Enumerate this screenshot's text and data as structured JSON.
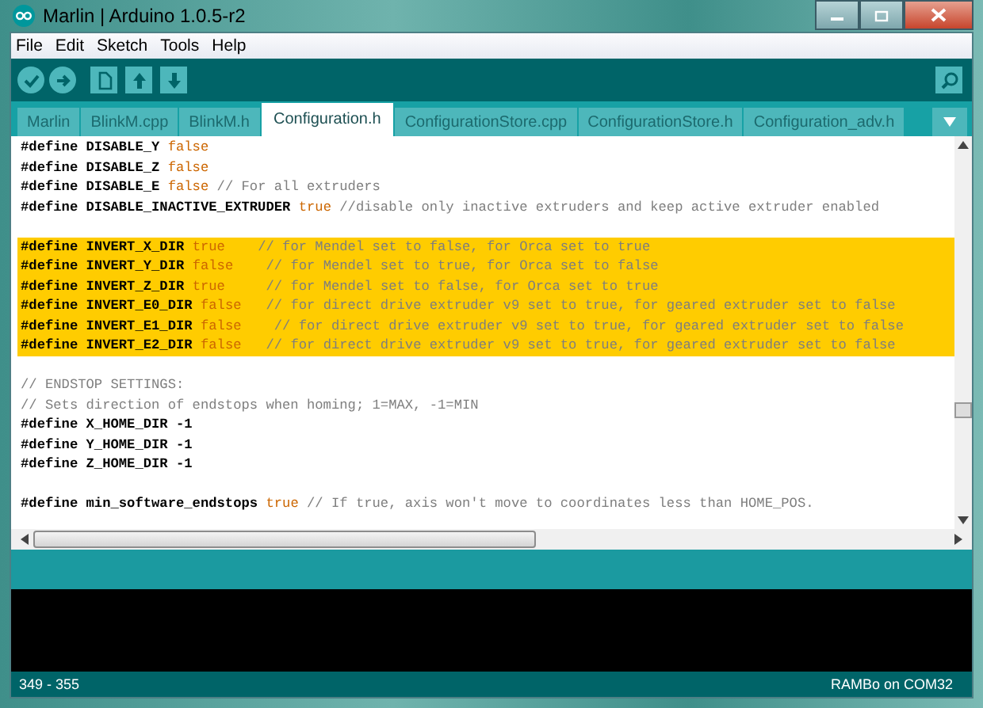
{
  "window": {
    "title": "Marlin | Arduino 1.0.5-r2"
  },
  "menu": [
    "File",
    "Edit",
    "Sketch",
    "Tools",
    "Help"
  ],
  "tabs": [
    {
      "label": "Marlin",
      "selected": false
    },
    {
      "label": "BlinkM.cpp",
      "selected": false
    },
    {
      "label": "BlinkM.h",
      "selected": false
    },
    {
      "label": "Configuration.h",
      "selected": true
    },
    {
      "label": "ConfigurationStore.cpp",
      "selected": false
    },
    {
      "label": "ConfigurationStore.h",
      "selected": false
    },
    {
      "label": "Configuration_adv.h",
      "selected": false
    }
  ],
  "lines": [
    {
      "highlighted": false,
      "segments": [
        {
          "kind": "code",
          "text": "#define DISABLE_Y "
        },
        {
          "kind": "literal",
          "text": "false"
        }
      ]
    },
    {
      "highlighted": false,
      "segments": [
        {
          "kind": "code",
          "text": "#define DISABLE_Z "
        },
        {
          "kind": "literal",
          "text": "false"
        }
      ]
    },
    {
      "highlighted": false,
      "segments": [
        {
          "kind": "code",
          "text": "#define DISABLE_E "
        },
        {
          "kind": "literal",
          "text": "false"
        },
        {
          "kind": "comment",
          "text": " // For all extruders"
        }
      ]
    },
    {
      "highlighted": false,
      "segments": [
        {
          "kind": "code",
          "text": "#define DISABLE_INACTIVE_EXTRUDER "
        },
        {
          "kind": "literal",
          "text": "true"
        },
        {
          "kind": "comment",
          "text": " //disable only inactive extruders and keep active extruder enabled"
        }
      ]
    },
    {
      "highlighted": false
    },
    {
      "highlighted": true,
      "segments": [
        {
          "kind": "code",
          "text": "#define INVERT_X_DIR "
        },
        {
          "kind": "literal",
          "text": "true"
        },
        {
          "kind": "comment",
          "text": "    // for Mendel set to false, for Orca set to true"
        }
      ]
    },
    {
      "highlighted": true,
      "segments": [
        {
          "kind": "code",
          "text": "#define INVERT_Y_DIR "
        },
        {
          "kind": "literal",
          "text": "false"
        },
        {
          "kind": "comment",
          "text": "    // for Mendel set to true, for Orca set to false"
        }
      ]
    },
    {
      "highlighted": true,
      "segments": [
        {
          "kind": "code",
          "text": "#define INVERT_Z_DIR "
        },
        {
          "kind": "literal",
          "text": "true"
        },
        {
          "kind": "comment",
          "text": "     // for Mendel set to false, for Orca set to true"
        }
      ]
    },
    {
      "highlighted": true,
      "segments": [
        {
          "kind": "code",
          "text": "#define INVERT_E0_DIR "
        },
        {
          "kind": "literal",
          "text": "false"
        },
        {
          "kind": "comment",
          "text": "   // for direct drive extruder v9 set to true, for geared extruder set to false"
        }
      ]
    },
    {
      "highlighted": true,
      "segments": [
        {
          "kind": "code",
          "text": "#define INVERT_E1_DIR "
        },
        {
          "kind": "literal",
          "text": "false"
        },
        {
          "kind": "comment",
          "text": "    // for direct drive extruder v9 set to true, for geared extruder set to false"
        }
      ]
    },
    {
      "highlighted": true,
      "segments": [
        {
          "kind": "code",
          "text": "#define INVERT_E2_DIR "
        },
        {
          "kind": "literal",
          "text": "false"
        },
        {
          "kind": "comment",
          "text": "   // for direct drive extruder v9 set to true, for geared extruder set to false"
        }
      ]
    },
    {
      "highlighted": false
    },
    {
      "highlighted": false,
      "segments": [
        {
          "kind": "comment",
          "text": "// ENDSTOP SETTINGS:"
        }
      ]
    },
    {
      "highlighted": false,
      "segments": [
        {
          "kind": "comment",
          "text": "// Sets direction of endstops when homing; 1=MAX, -1=MIN"
        }
      ]
    },
    {
      "highlighted": false,
      "segments": [
        {
          "kind": "code",
          "text": "#define X_HOME_DIR -1"
        }
      ]
    },
    {
      "highlighted": false,
      "segments": [
        {
          "kind": "code",
          "text": "#define Y_HOME_DIR -1"
        }
      ]
    },
    {
      "highlighted": false,
      "segments": [
        {
          "kind": "code",
          "text": "#define Z_HOME_DIR -1"
        }
      ]
    },
    {
      "highlighted": false
    },
    {
      "highlighted": false,
      "segments": [
        {
          "kind": "code",
          "text": "#define min_software_endstops "
        },
        {
          "kind": "literal",
          "text": "true"
        },
        {
          "kind": "comment",
          "text": " // If true, axis won't move to coordinates less than HOME_POS."
        }
      ]
    }
  ],
  "status_bar": {
    "line_range": "349 - 355",
    "board": "RAMBo on COM32"
  }
}
